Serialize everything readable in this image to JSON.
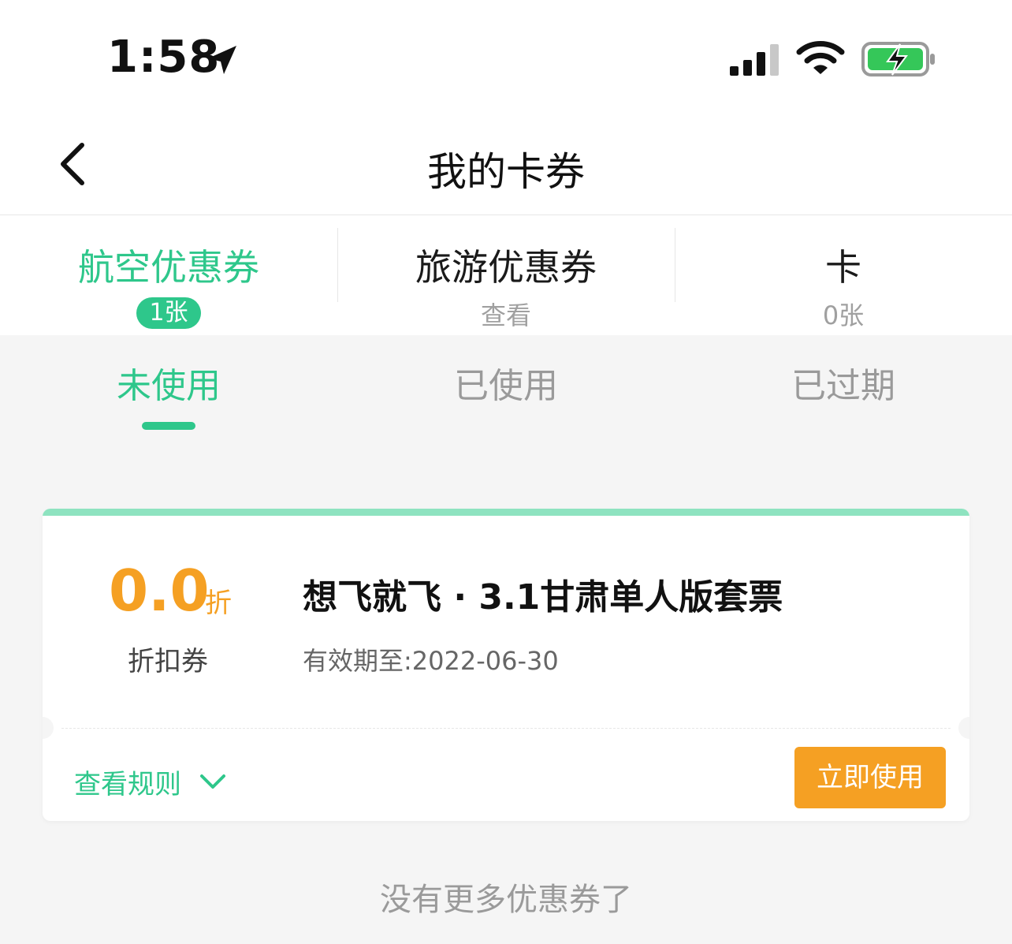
{
  "status_bar": {
    "time": "1:58"
  },
  "header": {
    "title": "我的卡券"
  },
  "category_tabs": [
    {
      "label": "航空优惠券",
      "sub": "1张",
      "active": true
    },
    {
      "label": "旅游优惠券",
      "sub": "查看",
      "active": false
    },
    {
      "label": "卡",
      "sub": "0张",
      "active": false
    }
  ],
  "status_tabs": [
    {
      "label": "未使用",
      "active": true
    },
    {
      "label": "已使用",
      "active": false
    },
    {
      "label": "已过期",
      "active": false
    }
  ],
  "coupon": {
    "discount_value": "0.0",
    "discount_unit": "折",
    "type": "折扣券",
    "name": "想飞就飞 · 3.1甘肃单人版套票",
    "expiry": "有效期至:2022-06-30",
    "rules_label": "查看规则",
    "use_label": "立即使用"
  },
  "footer": {
    "no_more": "没有更多优惠券了"
  },
  "colors": {
    "accent_green": "#2ec78b",
    "accent_orange": "#f5a023"
  }
}
